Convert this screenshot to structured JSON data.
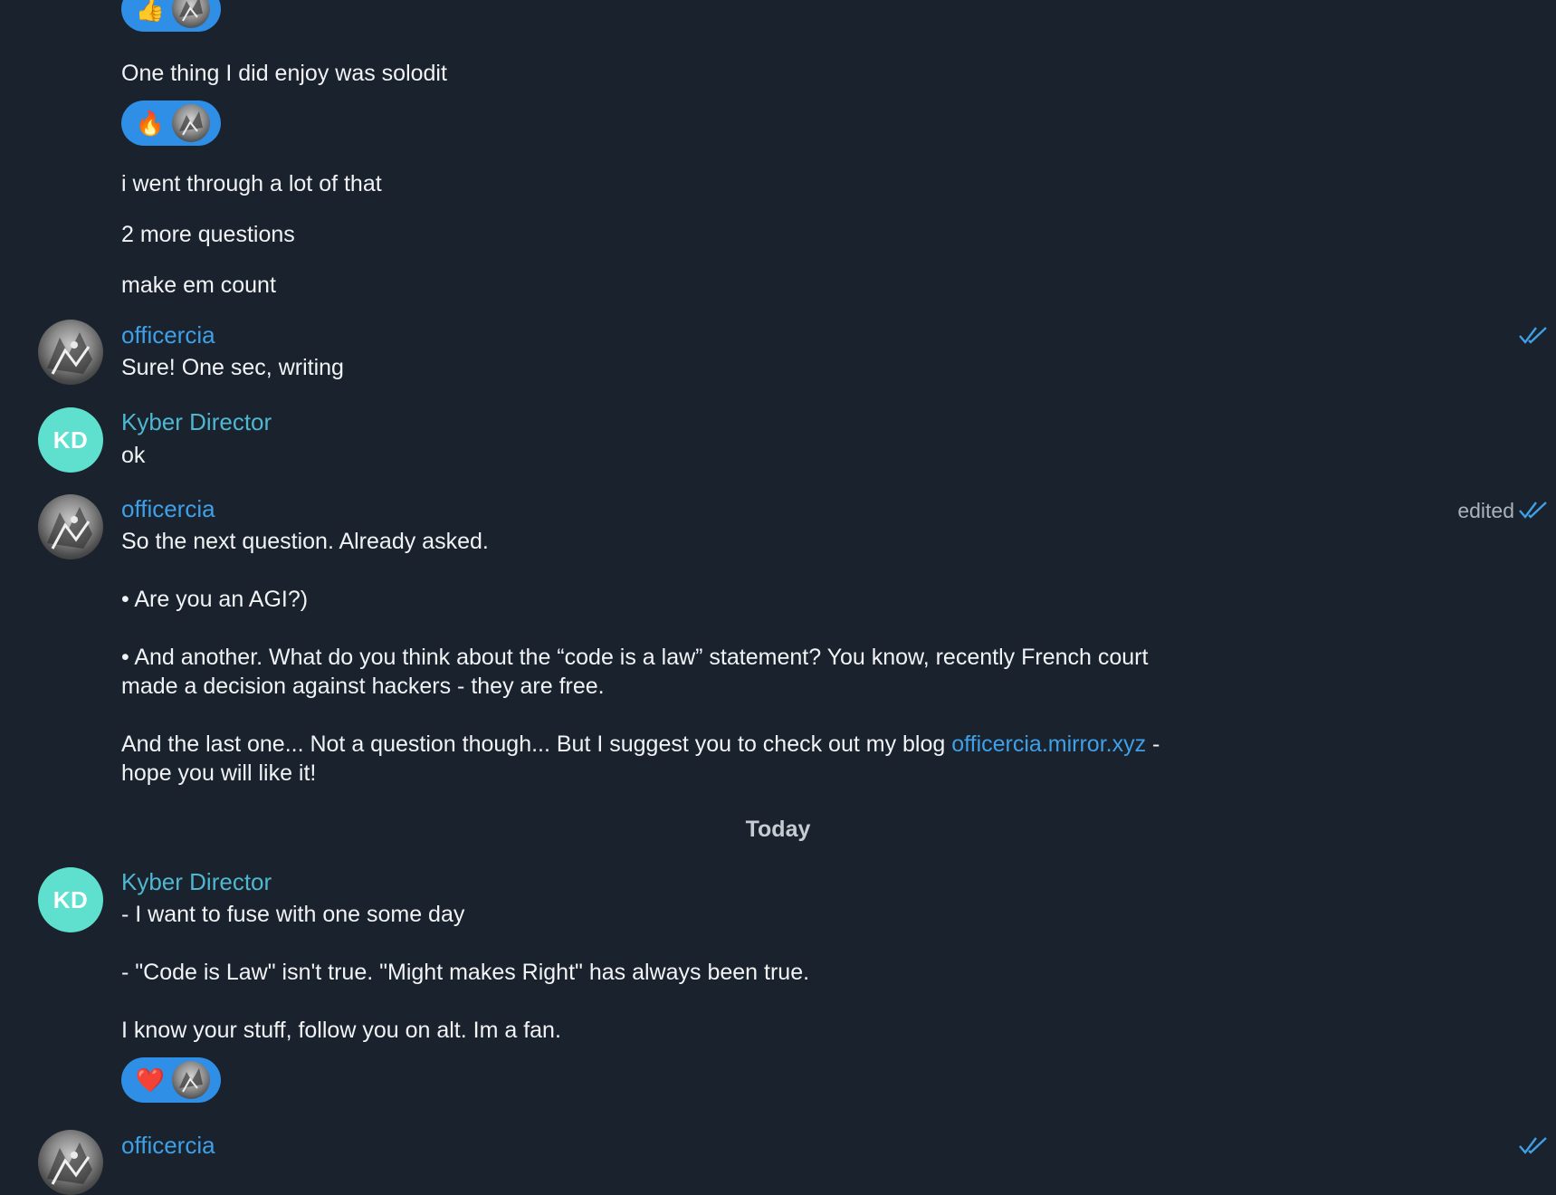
{
  "reactions": {
    "top": {
      "emoji": "👍"
    },
    "solodit": {
      "emoji": "🔥"
    },
    "fan": {
      "emoji": "❤️"
    }
  },
  "messages_prev": {
    "solodit": "One thing I did enjoy was solodit",
    "went": "i went through a lot of that",
    "more": "2 more questions",
    "count": "make em count"
  },
  "msg1": {
    "author": "officercia",
    "text": "Sure! One sec, writing"
  },
  "msg2": {
    "author": "Kyber Director",
    "initials": "KD",
    "text": "ok"
  },
  "msg3": {
    "author": "officercia",
    "edited": "edited",
    "line1": "So the next question. Already asked.",
    "line2": "• Are you an AGI?)",
    "line3a": "• And another. What do you think about the “code is a law” statement? You know, recently French court",
    "line3b": "made a decision against hackers - they are free.",
    "line4a_pre": "And the last one... Not a question though... But I suggest you to check out my blog ",
    "line4a_link": "officercia.mirror.xyz",
    "line4a_post": " -",
    "line4b": "hope you will like it!"
  },
  "date_separator": "Today",
  "msg4": {
    "author": "Kyber Director",
    "initials": "KD",
    "line1": "- I want to fuse with one some day",
    "line2": "- \"Code is Law\" isn't true. \"Might makes Right\" has always been true.",
    "line3": "I know your stuff, follow you on alt. Im a fan."
  },
  "msg5": {
    "author": "officercia"
  },
  "colors": {
    "background": "#19222d",
    "link": "#3fa0e8",
    "reaction_pill": "#2f8fe6",
    "kd_avatar": "#5fe0cf"
  },
  "icons": [
    "thumbs-up",
    "fire",
    "heart",
    "double-check"
  ]
}
